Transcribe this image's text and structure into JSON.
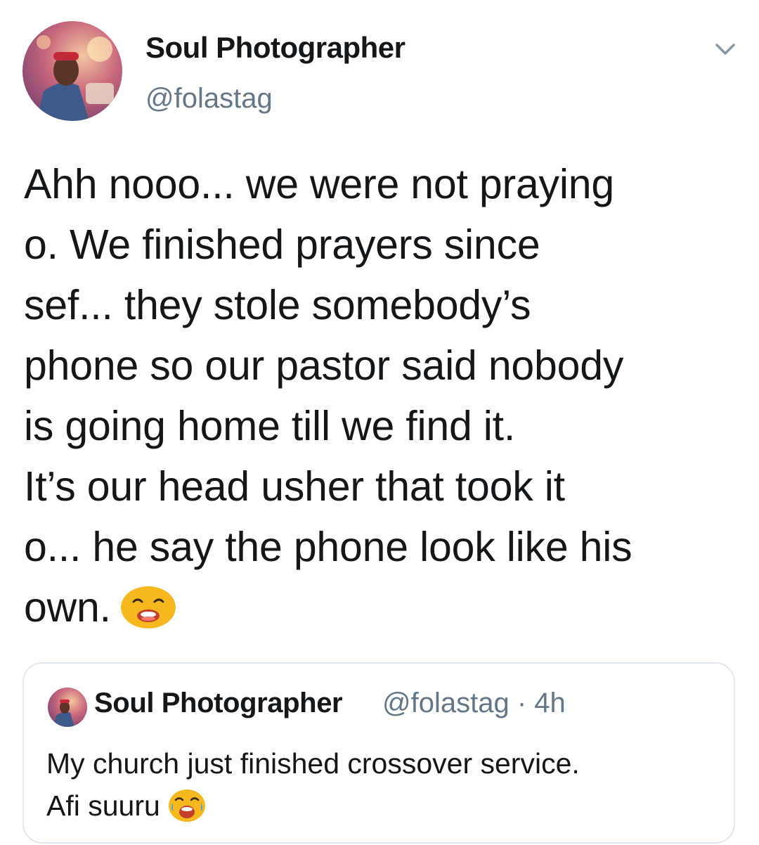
{
  "tweet": {
    "display_name": "Soul Photographer",
    "handle": "@folastag",
    "body_lines": [
      "Ahh nooo... we were not praying",
      "o. We finished prayers since",
      "sef... they stole somebody’s",
      "phone so our pastor said nobody",
      "is going home till we find it.",
      "It’s our head usher that took it",
      "o... he say the phone look like his",
      "own."
    ],
    "body_emoji": "weary-face-icon"
  },
  "quoted_tweet": {
    "display_name": "Soul Photographer",
    "meta": "@folastag · 4h",
    "lines": [
      "My church just finished crossover service.",
      "Afi suuru"
    ],
    "emoji": "face-with-tears-of-joy-icon"
  },
  "colors": {
    "text": "#14171a",
    "secondary": "#657786",
    "border": "#e1e8ed",
    "emoji_yellow": "#f5b81f"
  }
}
